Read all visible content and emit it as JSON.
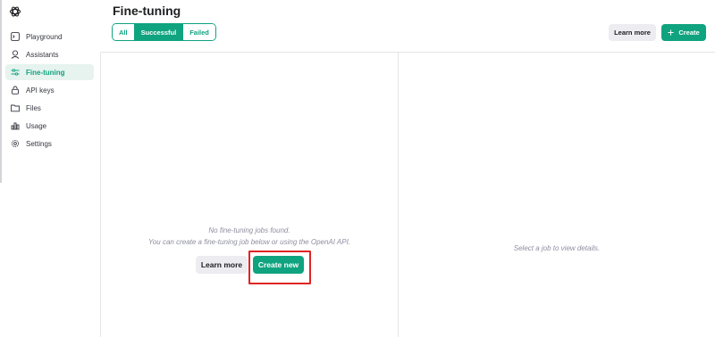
{
  "sidebar": {
    "items": [
      {
        "label": "Playground",
        "icon": "terminal-icon"
      },
      {
        "label": "Assistants",
        "icon": "assistant-icon"
      },
      {
        "label": "Fine-tuning",
        "icon": "sliders-icon",
        "active": true
      },
      {
        "label": "API keys",
        "icon": "lock-icon"
      },
      {
        "label": "Files",
        "icon": "folder-icon"
      },
      {
        "label": "Usage",
        "icon": "bar-chart-icon"
      },
      {
        "label": "Settings",
        "icon": "gear-icon"
      }
    ]
  },
  "header": {
    "title": "Fine-tuning",
    "filters": [
      {
        "label": "All"
      },
      {
        "label": "Successful",
        "active": true
      },
      {
        "label": "Failed"
      }
    ],
    "learn_more_label": "Learn more",
    "create_label": "Create",
    "create_icon": "plus-icon"
  },
  "jobs_panel": {
    "empty_line_1": "No fine-tuning jobs found.",
    "empty_line_2": "You can create a fine-tuning job below or using the OpenAI API.",
    "learn_more_label": "Learn more",
    "create_new_label": "Create new"
  },
  "details_panel": {
    "placeholder": "Select a job to view details."
  },
  "colors": {
    "accent": "#10a37f",
    "highlight": "#e02424"
  }
}
